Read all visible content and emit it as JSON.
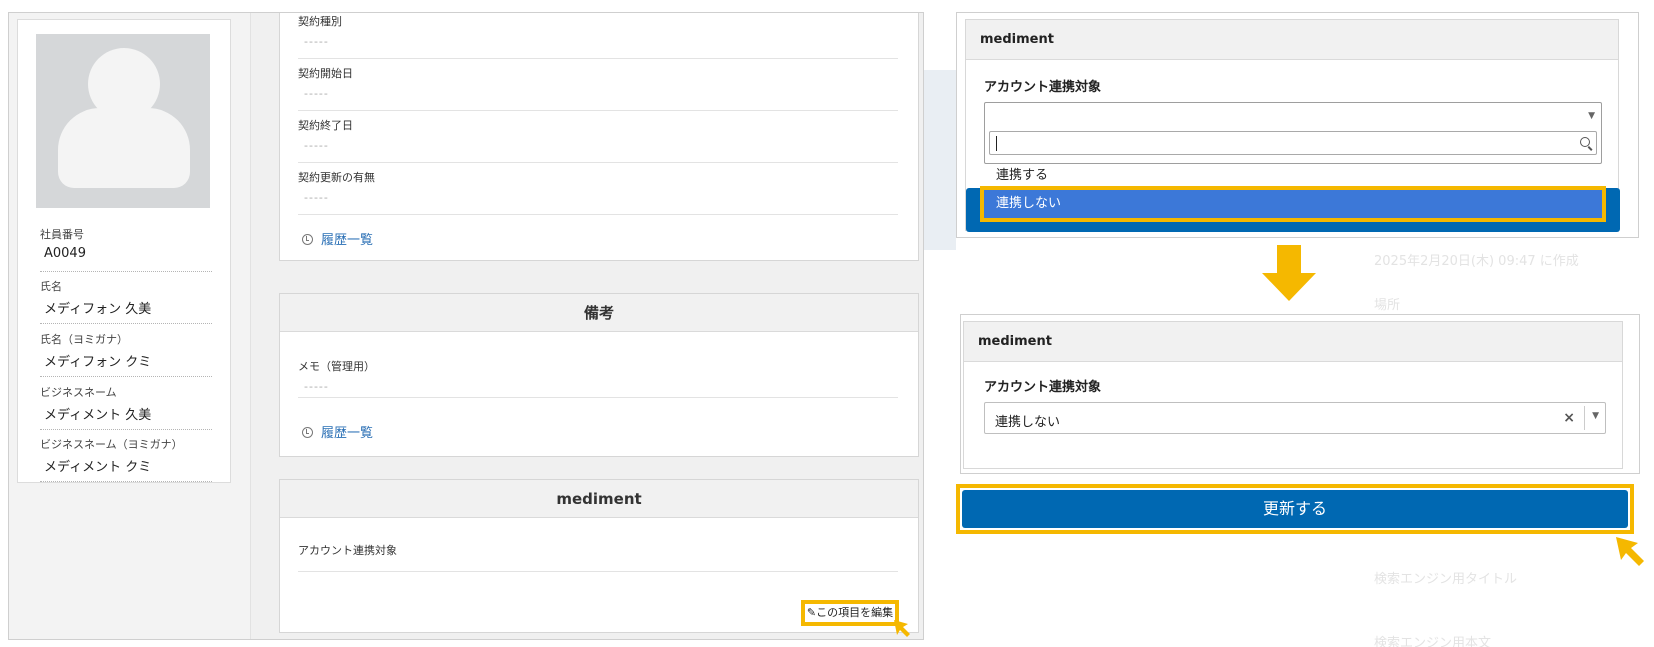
{
  "profile": {
    "fields": [
      {
        "label": "社員番号",
        "value": "A0049"
      },
      {
        "label": "氏名",
        "value": "メディフォン 久美"
      },
      {
        "label": "氏名（ヨミガナ）",
        "value": "メディフォン クミ"
      },
      {
        "label": "ビジネスネーム",
        "value": "メディメント 久美"
      },
      {
        "label": "ビジネスネーム（ヨミガナ）",
        "value": "メディメント クミ"
      }
    ]
  },
  "contract": {
    "rows": [
      {
        "label": "契約種別",
        "value": "-----"
      },
      {
        "label": "契約開始日",
        "value": "-----"
      },
      {
        "label": "契約終了日",
        "value": "-----"
      },
      {
        "label": "契約更新の有無",
        "value": "-----"
      }
    ],
    "history_link": "履歴一覧"
  },
  "remarks": {
    "title": "備考",
    "rows": [
      {
        "label": "メモ（管理用）",
        "value": "-----"
      }
    ],
    "history_link": "履歴一覧"
  },
  "mediment_left": {
    "title": "mediment",
    "field_label": "アカウント連携対象",
    "edit_button": "この項目を編集"
  },
  "dropdown_step": {
    "title": "mediment",
    "field_label": "アカウント連携対象",
    "search_value": "",
    "options": [
      "連携する",
      "連携しない"
    ],
    "highlighted_option": "連携しない"
  },
  "result_step": {
    "title": "mediment",
    "field_label": "アカウント連携対象",
    "selected_value": "連携しない",
    "update_button": "更新する"
  },
  "background_text": {
    "line1": "2025年2月20日(木) 09:47 に作成",
    "line2": "場所",
    "line3": "検索エンジン用タイトル",
    "line4": "検索エンジン用本文"
  },
  "colors": {
    "highlight": "#f5b800",
    "primary": "#0068b2",
    "selected_option": "#3c78d8"
  }
}
